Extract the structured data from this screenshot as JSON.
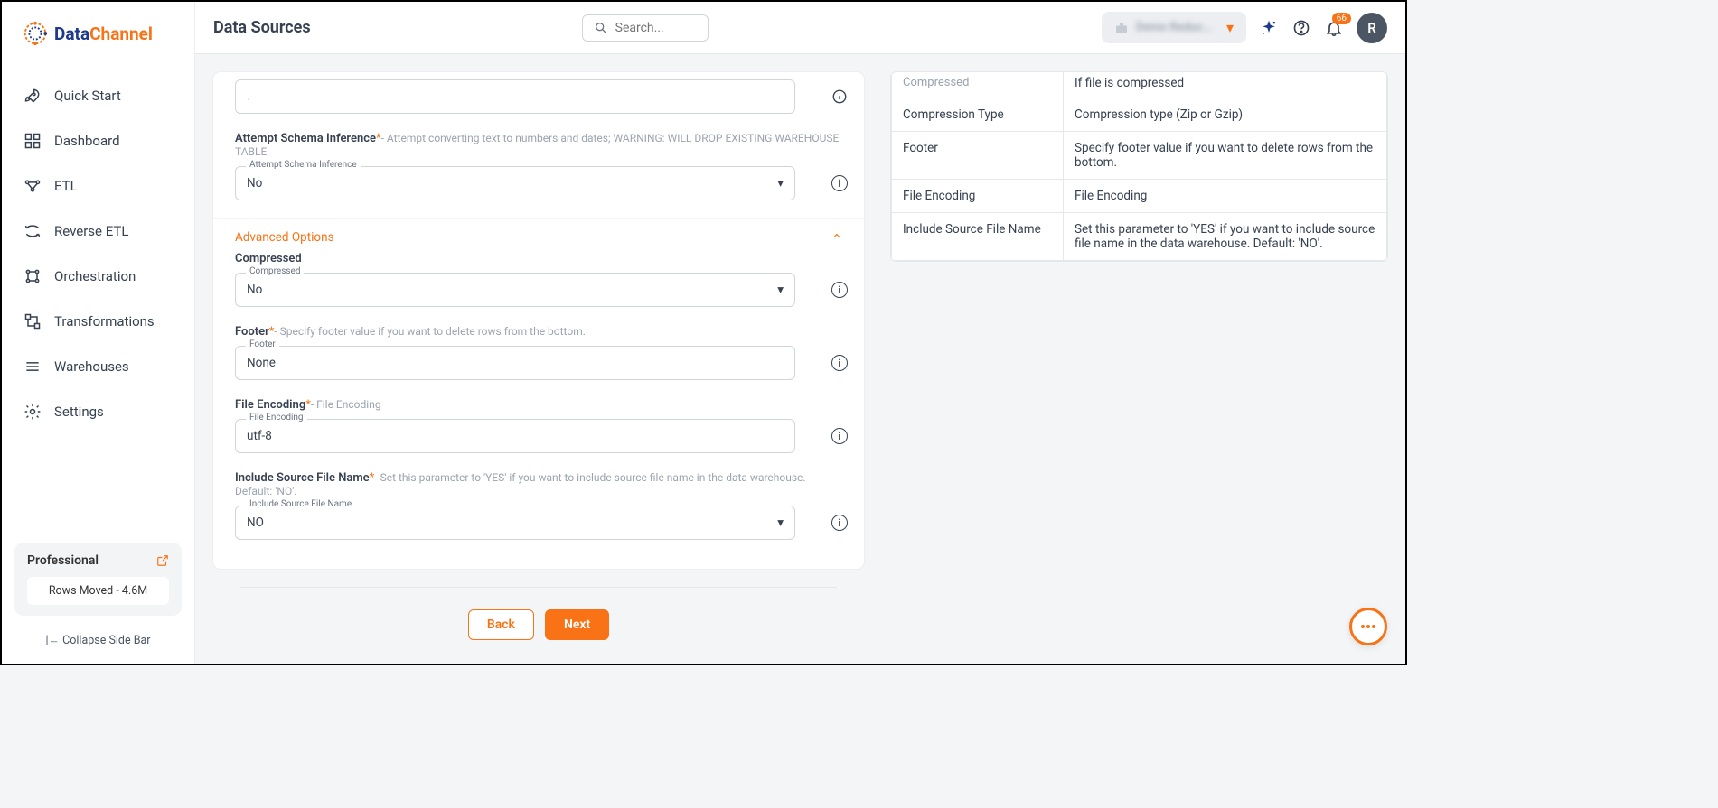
{
  "logo": {
    "part1": "Data",
    "part2": "Channel"
  },
  "header": {
    "title": "Data Sources",
    "search_placeholder": "Search...",
    "org_label": "Demo Reduc...",
    "badge": "66",
    "avatar_initial": "R"
  },
  "sidebar": {
    "items": [
      {
        "label": "Quick Start"
      },
      {
        "label": "Dashboard"
      },
      {
        "label": "ETL"
      },
      {
        "label": "Reverse ETL"
      },
      {
        "label": "Orchestration"
      },
      {
        "label": "Transformations"
      },
      {
        "label": "Warehouses"
      },
      {
        "label": "Settings"
      }
    ],
    "plan": {
      "name": "Professional",
      "rows": "Rows Moved - 4.6M"
    },
    "collapse": "Collapse Side Bar"
  },
  "form": {
    "schema_inference": {
      "label": "Attempt Schema Inference",
      "hint": "- Attempt converting text to numbers and dates; WARNING: WILL DROP EXISTING WAREHOUSE TABLE",
      "float": "Attempt Schema Inference",
      "value": "No"
    },
    "advanced_title": "Advanced Options",
    "compressed": {
      "label": "Compressed",
      "float": "Compressed",
      "value": "No"
    },
    "footer": {
      "label": "Footer",
      "hint": "- Specify footer value if you want to delete rows from the bottom.",
      "float": "Footer",
      "value": "None"
    },
    "encoding": {
      "label": "File Encoding",
      "hint": "- File Encoding",
      "float": "File Encoding",
      "value": "utf-8"
    },
    "include_src": {
      "label": "Include Source File Name",
      "hint": "- Set this parameter to 'YES' if you want to include source file name in the data warehouse. Default: 'NO'.",
      "float": "Include Source File Name",
      "value": "NO"
    },
    "back": "Back",
    "next": "Next"
  },
  "help": {
    "rows": [
      {
        "k": "Compressed",
        "v": "If file is compressed"
      },
      {
        "k": "Compression Type",
        "v": "Compression type (Zip or Gzip)"
      },
      {
        "k": "Footer",
        "v": "Specify footer value if you want to delete rows from the bottom."
      },
      {
        "k": "File Encoding",
        "v": "File Encoding"
      },
      {
        "k": "Include Source File Name",
        "v": "Set this parameter to 'YES' if you want to include source file name in the data warehouse. Default: 'NO'."
      }
    ]
  }
}
